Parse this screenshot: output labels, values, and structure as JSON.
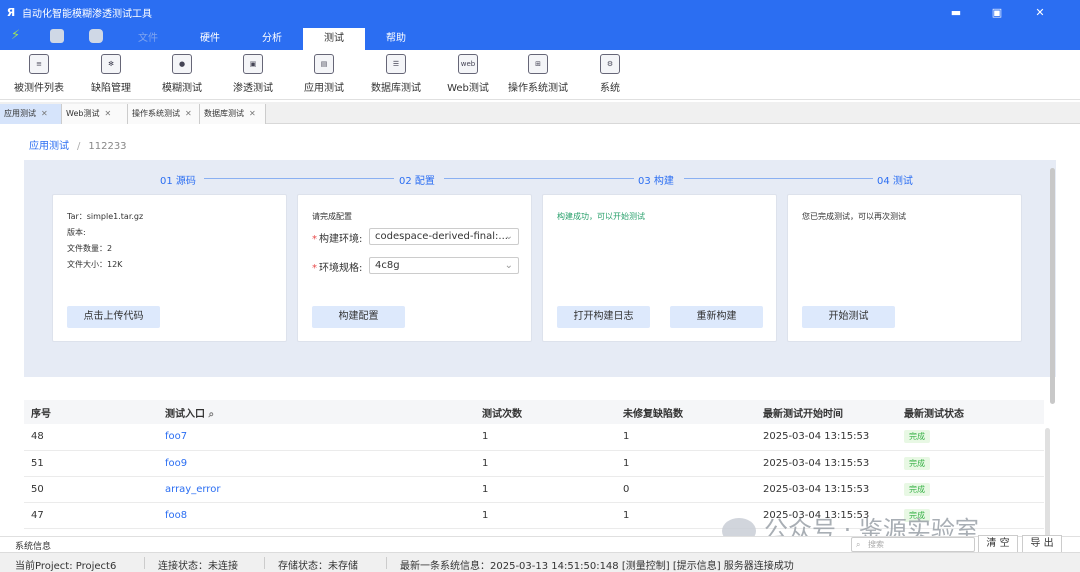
{
  "titlebar": {
    "app_title": "自动化智能模糊渗透测试工具",
    "minimize": "▬",
    "maximize": "▣",
    "close": "✕"
  },
  "menubar": {
    "tabs": [
      {
        "label": "文件"
      },
      {
        "label": "硬件"
      },
      {
        "label": "分析"
      },
      {
        "label": "测试"
      },
      {
        "label": "帮助"
      }
    ]
  },
  "ribbon": {
    "items": [
      {
        "label": "被测件列表",
        "icon": "list-icon"
      },
      {
        "label": "缺陷管理",
        "icon": "bug-icon"
      },
      {
        "label": "模糊测试",
        "icon": "fuzz-icon"
      },
      {
        "label": "渗透测试",
        "icon": "penetration-icon"
      },
      {
        "label": "应用测试",
        "icon": "app-test-icon"
      },
      {
        "label": "数据库测试",
        "icon": "database-icon"
      },
      {
        "label": "Web测试",
        "icon": "web-icon",
        "icon_text": "web"
      },
      {
        "label": "操作系统测试",
        "icon": "windows-icon"
      },
      {
        "label": "系统",
        "icon": "system-icon"
      }
    ]
  },
  "doc_tabs": [
    {
      "label": "应用测试"
    },
    {
      "label": "Web测试"
    },
    {
      "label": "操作系统测试"
    },
    {
      "label": "数据库测试"
    }
  ],
  "breadcrumb": {
    "root": "应用测试",
    "sep": "/",
    "current": "112233"
  },
  "steps": [
    {
      "label": "01 源码"
    },
    {
      "label": "02 配置"
    },
    {
      "label": "03 构建"
    },
    {
      "label": "04 测试"
    }
  ],
  "source_card": {
    "tar": "Tar：simple1.tar.gz",
    "version": "版本:",
    "file_count": "文件数量：2",
    "file_size": "文件大小：12K",
    "upload_button": "点击上传代码"
  },
  "config_card": {
    "heading": "请完成配置",
    "env_label": "构建环境:",
    "env_value": "codespace-derived-final:...",
    "spec_label": "环境规格:",
    "spec_value": "4c8g",
    "build_config_button": "构建配置"
  },
  "build_card": {
    "message": "构建成功，可以开始测试",
    "log_button": "打开构建日志",
    "rebuild_button": "重新构建"
  },
  "test_card": {
    "message": "您已完成测试，可以再次测试",
    "start_button": "开始测试"
  },
  "table": {
    "headers": [
      "序号",
      "测试入口",
      "测试次数",
      "未修复缺陷数",
      "最新测试开始时间",
      "最新测试状态"
    ],
    "rows": [
      {
        "id": "48",
        "entry": "foo7",
        "count": "1",
        "defects": "1",
        "time": "2025-03-04  13:15:53",
        "status": "完成"
      },
      {
        "id": "51",
        "entry": "foo9",
        "count": "1",
        "defects": "1",
        "time": "2025-03-04  13:15:53",
        "status": "完成"
      },
      {
        "id": "50",
        "entry": "array_error",
        "count": "1",
        "defects": "0",
        "time": "2025-03-04  13:15:53",
        "status": "完成"
      },
      {
        "id": "47",
        "entry": "foo8",
        "count": "1",
        "defects": "1",
        "time": "2025-03-04  13:15:53",
        "status": "完成"
      }
    ]
  },
  "sysinfo": {
    "label": "系统信息",
    "search_placeholder": "搜索",
    "clear_button": "清 空",
    "export_button": "导 出"
  },
  "status": {
    "project": "当前Project:  Project6",
    "connection": "连接状态：未连接",
    "storage": "存储状态：未存储",
    "latest": "最新一条系统信息：2025-03-13  14:51:50:148  [测量控制]  [提示信息]  服务器连接成功"
  },
  "watermark": "公众号 · 鉴源实验室",
  "colors": {
    "accent": "#2b6ef2",
    "success": "#28a06b",
    "panel": "#e6ebf5"
  }
}
